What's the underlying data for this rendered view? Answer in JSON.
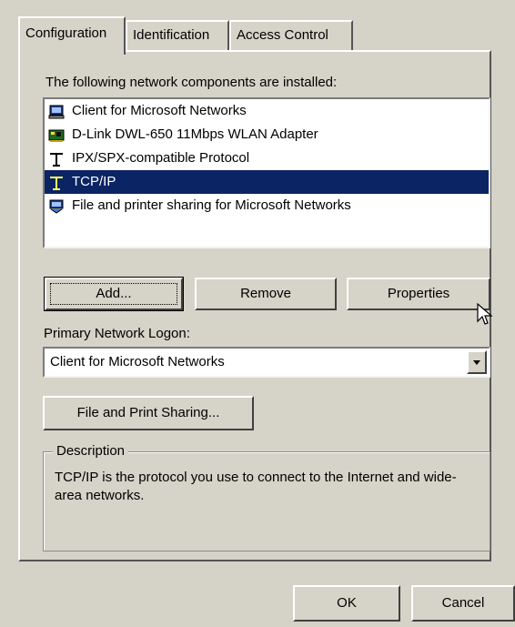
{
  "tabs": [
    {
      "label": "Configuration",
      "active": true
    },
    {
      "label": "Identification",
      "active": false
    },
    {
      "label": "Access Control",
      "active": false
    }
  ],
  "components_label": "The following network components are installed:",
  "components": [
    {
      "label": "Client for Microsoft Networks",
      "icon": "client-icon",
      "selected": false
    },
    {
      "label": "D-Link DWL-650 11Mbps WLAN Adapter",
      "icon": "network-adapter-icon",
      "selected": false
    },
    {
      "label": "IPX/SPX-compatible Protocol",
      "icon": "protocol-icon",
      "selected": false
    },
    {
      "label": "TCP/IP",
      "icon": "protocol-icon",
      "selected": true
    },
    {
      "label": "File and printer sharing for Microsoft Networks",
      "icon": "file-sharing-icon",
      "selected": false
    }
  ],
  "buttons": {
    "add": "Add...",
    "remove": "Remove",
    "properties": "Properties",
    "file_print_sharing": "File and Print Sharing...",
    "ok": "OK",
    "cancel": "Cancel"
  },
  "logon": {
    "label": "Primary Network Logon:",
    "value": "Client for Microsoft Networks"
  },
  "description": {
    "legend": "Description",
    "text": "TCP/IP is the protocol you use to connect to the Internet and wide-area networks."
  },
  "colors": {
    "selection": "#0b2463",
    "face": "#d6d3c8"
  }
}
